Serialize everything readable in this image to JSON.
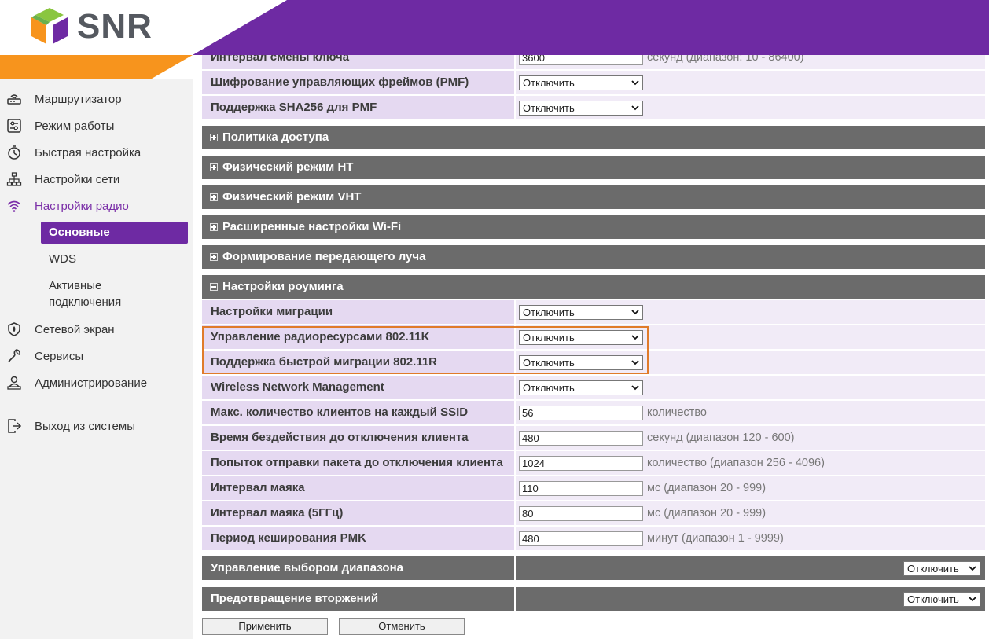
{
  "brand": {
    "name": "SNR",
    "colors": {
      "purple": "#6e2aa3",
      "orange": "#f7941d",
      "gray": "#555960"
    }
  },
  "sidebar": {
    "items": [
      {
        "label": "Маршрутизатор",
        "icon": "router-icon"
      },
      {
        "label": "Режим работы",
        "icon": "mode-icon"
      },
      {
        "label": "Быстрая настройка",
        "icon": "stopwatch-icon"
      },
      {
        "label": "Настройки сети",
        "icon": "network-icon"
      },
      {
        "label": "Настройки радио",
        "icon": "wifi-icon"
      }
    ],
    "sub_items": [
      {
        "label": "Основные"
      },
      {
        "label": "WDS"
      },
      {
        "label": "Активные подключения"
      }
    ],
    "items2": [
      {
        "label": "Сетевой экран",
        "icon": "shield-icon"
      },
      {
        "label": "Сервисы",
        "icon": "wrench-icon"
      },
      {
        "label": "Администрирование",
        "icon": "admin-icon"
      }
    ],
    "logout": {
      "label": "Выход из системы",
      "icon": "logout-icon"
    }
  },
  "top_rows": [
    {
      "label": "Интервал смены ключа",
      "value": "3600",
      "unit": "секунд (диапазон: 10 - 86400)"
    },
    {
      "label": "Шифрование управляющих фреймов (PMF)",
      "select": "Отключить"
    },
    {
      "label": "Поддержка SHA256 для PMF",
      "select": "Отключить"
    }
  ],
  "sections": [
    {
      "label": "Политика доступа"
    },
    {
      "label": "Физический режим HT"
    },
    {
      "label": "Физический режим VHT"
    },
    {
      "label": "Расширенные настройки Wi-Fi"
    },
    {
      "label": "Формирование передающего луча"
    },
    {
      "label": "Настройки роуминга"
    }
  ],
  "roaming_rows": [
    {
      "label": "Настройки миграции",
      "select": "Отключить"
    },
    {
      "label": "Управление радиоресурсами 802.11K",
      "select": "Отключить"
    },
    {
      "label": "Поддержка быстрой миграции 802.11R",
      "select": "Отключить"
    },
    {
      "label": "Wireless Network Management",
      "select": "Отключить"
    },
    {
      "label": "Макс. количество клиентов на каждый SSID",
      "value": "56",
      "unit": "количество"
    },
    {
      "label": "Время бездействия до отключения клиента",
      "value": "480",
      "unit": "секунд (диапазон 120 - 600)"
    },
    {
      "label": "Попыток отправки пакета до отключения клиента",
      "value": "1024",
      "unit": "количество (диапазон 256 - 4096)"
    },
    {
      "label": "Интервал маяка",
      "value": "110",
      "unit": "мс (диапазон 20 - 999)"
    },
    {
      "label": "Интервал маяка (5ГГц)",
      "value": "80",
      "unit": "мс (диапазон 20 - 999)"
    },
    {
      "label": "Период кеширования PMK",
      "value": "480",
      "unit": "минут (диапазон 1 - 9999)"
    }
  ],
  "bottom_sections": [
    {
      "label": "Управление выбором диапазона",
      "select": "Отключить"
    },
    {
      "label": "Предотвращение вторжений",
      "select": "Отключить"
    }
  ],
  "buttons": {
    "apply": "Применить",
    "cancel": "Отменить"
  }
}
